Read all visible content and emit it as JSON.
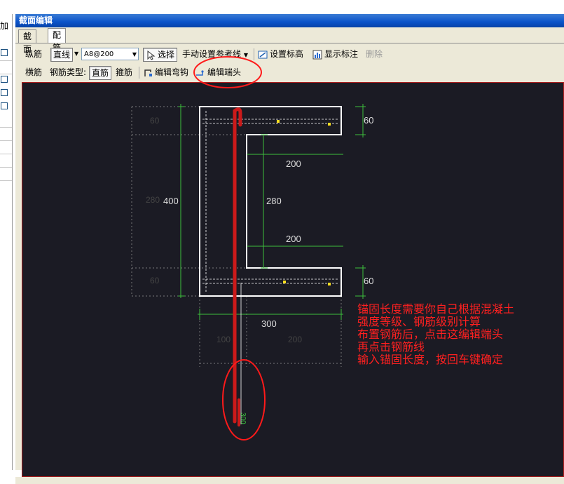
{
  "left_panel": {
    "add_label": "加"
  },
  "window": {
    "title": "截面编辑"
  },
  "tabs": [
    {
      "label": "截面"
    },
    {
      "label": "配筋"
    }
  ],
  "toolbar1": {
    "longitudinal_label": "纵筋",
    "line_mode": "直线",
    "rebar_spec": "A8@200",
    "select_label": "选择",
    "ref_line_label": "手动设置参考线",
    "set_elevation_label": "设置标高",
    "show_annotation_label": "显示标注",
    "delete_label": "删除"
  },
  "toolbar2": {
    "transverse_label": "横筋",
    "rebar_type_label": "钢筋类型:",
    "straight_bar": "直筋",
    "stirrup": "箍筋",
    "edit_bend_label": "编辑弯钩",
    "edit_end_label": "编辑端头"
  },
  "drawing": {
    "dims": {
      "top_left_60": "60",
      "left_280": "280",
      "left_400": "400",
      "bottom_left_60": "60",
      "right_top_60": "60",
      "right_200_top": "200",
      "right_280": "280",
      "right_200_mid": "200",
      "right_bottom_60": "60",
      "bottom_300": "300",
      "bottom_100": "100",
      "bottom_200": "200",
      "anchor_300": "300"
    }
  },
  "annotation": {
    "lines": [
      "锚固长度需要你自己根据混凝土",
      "强度等级、钢筋级别计算",
      "布置钢筋后，点击这编辑端头",
      "再点击钢筋线",
      "输入锚固长度，按回车键确定"
    ]
  },
  "colors": {
    "canvas_bg": "#1b1b24",
    "dim_green": "#3cbf3c",
    "rebar_red": "#cc1a1a",
    "annot_red": "#ff2020"
  }
}
